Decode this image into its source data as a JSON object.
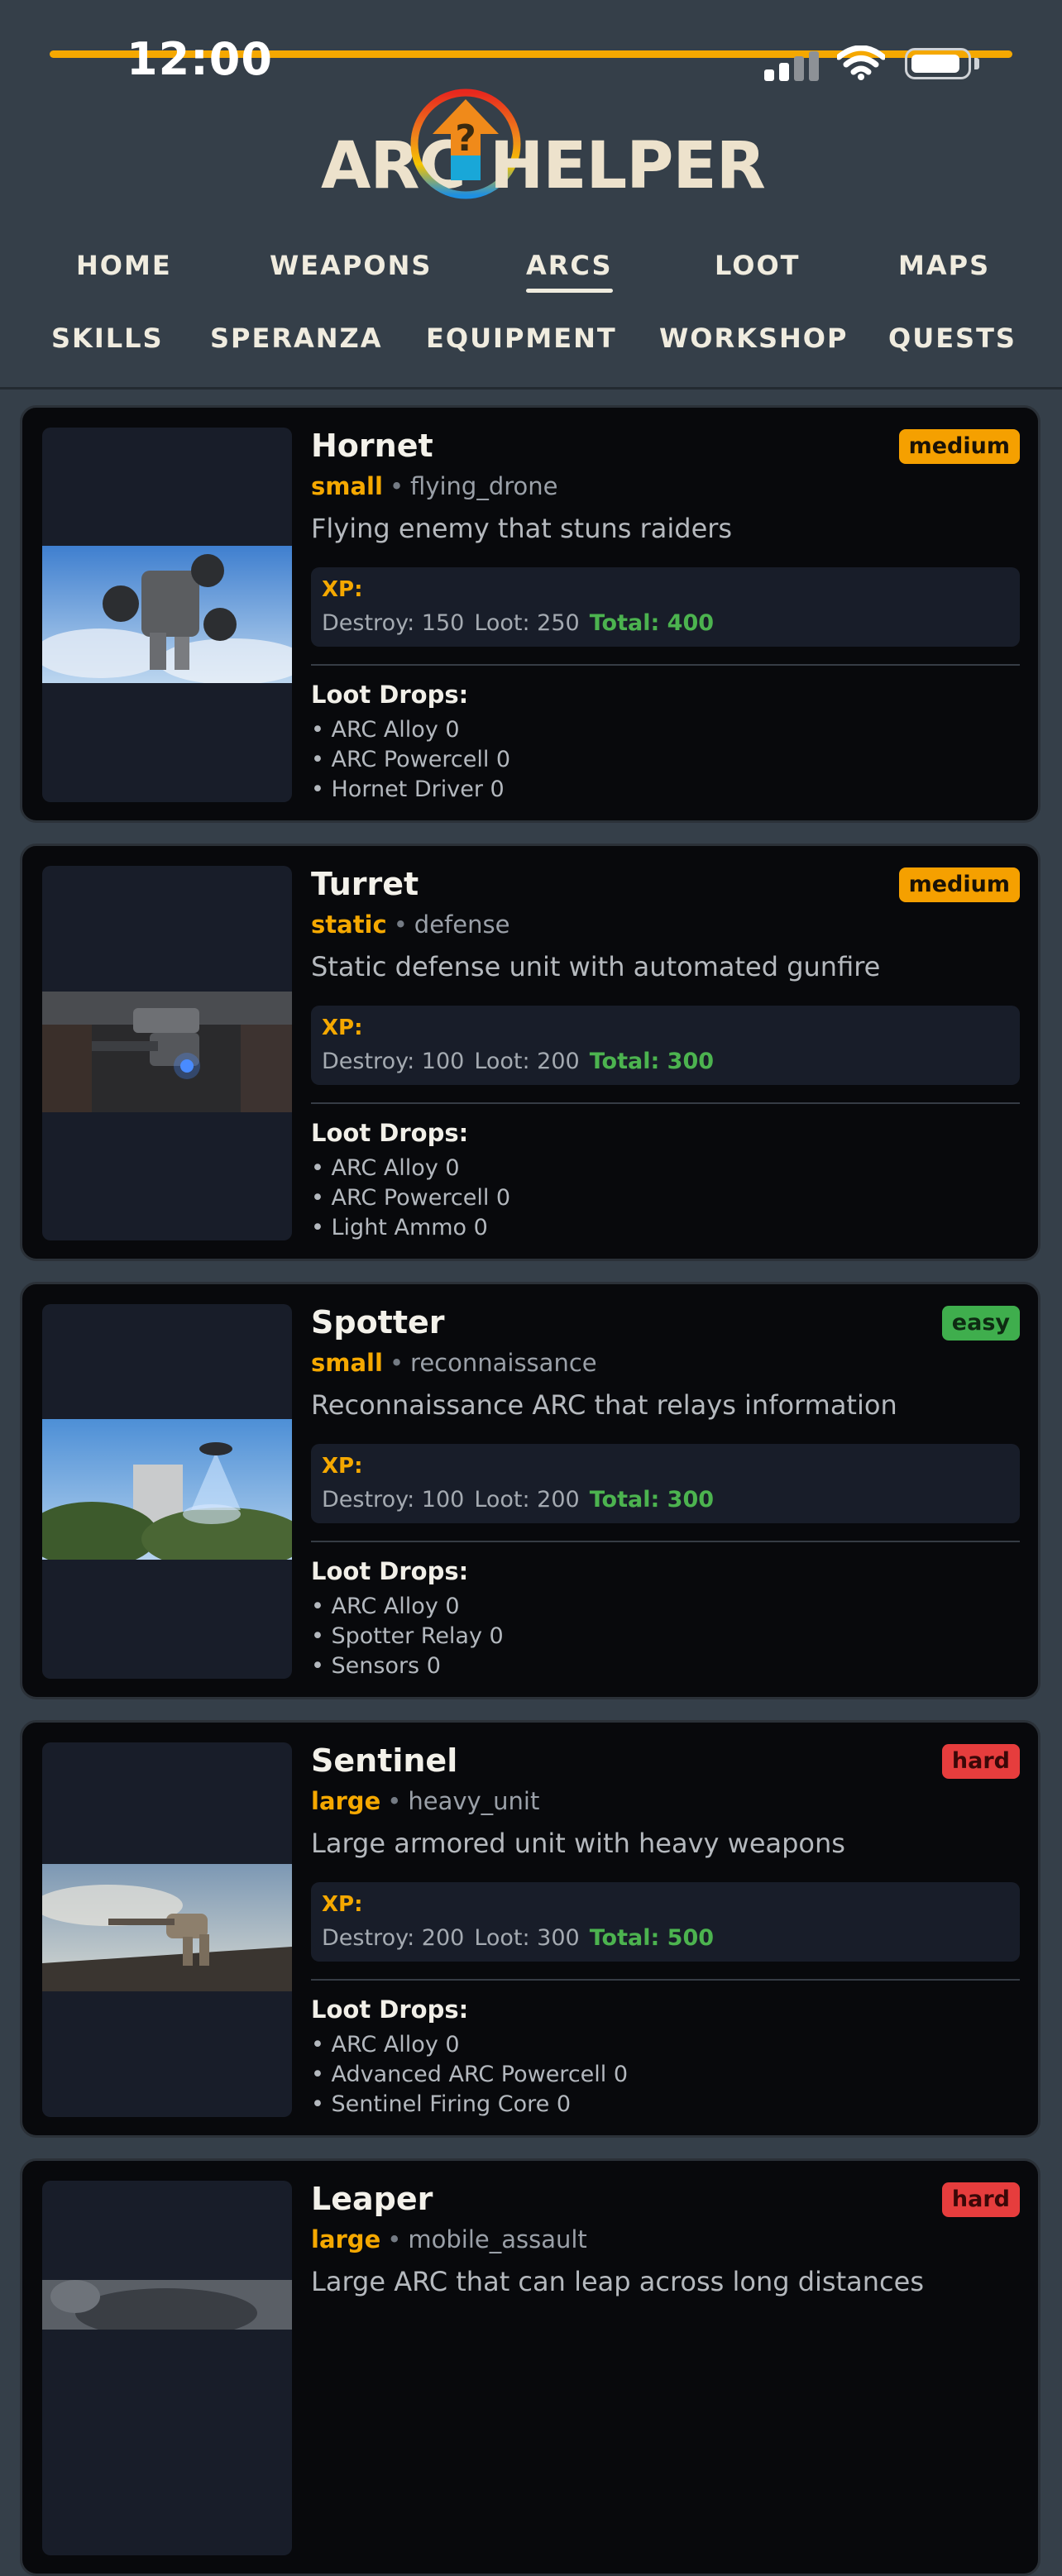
{
  "status_bar": {
    "time": "12:00"
  },
  "logo": {
    "left_text": "ARC",
    "right_text": "HELPER",
    "emblem_glyph": "?"
  },
  "nav": {
    "row1": [
      "HOME",
      "WEAPONS",
      "ARCS",
      "LOOT",
      "MAPS"
    ],
    "row2": [
      "SKILLS",
      "SPERANZA",
      "EQUIPMENT",
      "WORKSHOP",
      "QUESTS"
    ],
    "active": "ARCS"
  },
  "xp_labels": {
    "xp": "XP:",
    "destroy": "Destroy:",
    "loot": "Loot:",
    "total": "Total:",
    "loot_drops": "Loot Drops:",
    "separator": "•"
  },
  "cards": [
    {
      "name": "Hornet",
      "difficulty": "medium",
      "size": "small",
      "category": "flying_drone",
      "description": "Flying enemy that stuns raiders",
      "xp": {
        "destroy": "Destroy: 150",
        "loot": "Loot: 250",
        "total": "Total: 400"
      },
      "loot_drops": [
        "• ARC Alloy 0",
        "• ARC Powercell 0",
        "• Hornet Driver 0"
      ]
    },
    {
      "name": "Turret",
      "difficulty": "medium",
      "size": "static",
      "category": "defense",
      "description": "Static defense unit with automated gunfire",
      "xp": {
        "destroy": "Destroy: 100",
        "loot": "Loot: 200",
        "total": "Total: 300"
      },
      "loot_drops": [
        "• ARC Alloy 0",
        "• ARC Powercell 0",
        "• Light Ammo 0"
      ]
    },
    {
      "name": "Spotter",
      "difficulty": "easy",
      "size": "small",
      "category": "reconnaissance",
      "description": "Reconnaissance ARC that relays information",
      "xp": {
        "destroy": "Destroy: 100",
        "loot": "Loot: 200",
        "total": "Total: 300"
      },
      "loot_drops": [
        "• ARC Alloy 0",
        "• Spotter Relay 0",
        "• Sensors 0"
      ]
    },
    {
      "name": "Sentinel",
      "difficulty": "hard",
      "size": "large",
      "category": "heavy_unit",
      "description": "Large armored unit with heavy weapons",
      "xp": {
        "destroy": "Destroy: 200",
        "loot": "Loot: 300",
        "total": "Total: 500"
      },
      "loot_drops": [
        "• ARC Alloy 0",
        "• Advanced ARC Powercell 0",
        "• Sentinel Firing Core 0"
      ]
    },
    {
      "name": "Leaper",
      "difficulty": "hard",
      "size": "large",
      "category": "mobile_assault",
      "description": "Large ARC that can leap across long distances"
    }
  ],
  "colors": {
    "accent": "#f5a800",
    "xp_total": "#4cb34f",
    "background": "#353f49",
    "card": "#08090c"
  }
}
